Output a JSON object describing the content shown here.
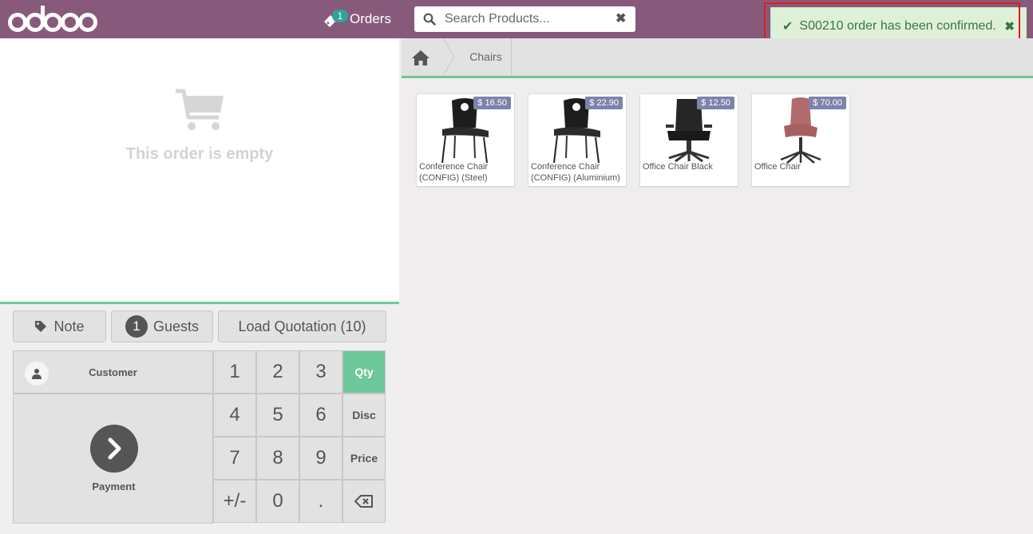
{
  "header": {
    "logo_text": "odoo",
    "orders_label": "Orders",
    "orders_count": "1",
    "search_placeholder": "Search Products...",
    "search_value": ""
  },
  "notification": {
    "message": "S00210 order has been confirmed."
  },
  "order": {
    "empty_text": "This order is empty"
  },
  "controls": {
    "note_label": "Note",
    "guests_count": "1",
    "guests_label": "Guests",
    "load_quotation_label": "Load Quotation (10)",
    "customer_label": "Customer",
    "payment_label": "Payment",
    "keys": [
      "1",
      "2",
      "3",
      "4",
      "5",
      "6",
      "7",
      "8",
      "9",
      "+/-",
      "0",
      "."
    ],
    "modes": [
      "Qty",
      "Disc",
      "Price"
    ]
  },
  "category": {
    "current": "Chairs"
  },
  "products": [
    {
      "name": "Conference Chair (CONFIG) (Steel)",
      "price": "$ 16.50",
      "color": "#222222"
    },
    {
      "name": "Conference Chair (CONFIG) (Aluminium)",
      "price": "$ 22.90",
      "color": "#222222"
    },
    {
      "name": "Office Chair Black",
      "price": "$ 12.50",
      "color": "#2a2a2a"
    },
    {
      "name": "Office Chair",
      "price": "$ 70.00",
      "color": "#b26b6b"
    }
  ],
  "colors": {
    "header": "#875a7b",
    "accent": "#6ec89b",
    "price_tag": "#7f82ac",
    "notification_bg": "#dff0d8",
    "notification_text": "#3c763d"
  }
}
